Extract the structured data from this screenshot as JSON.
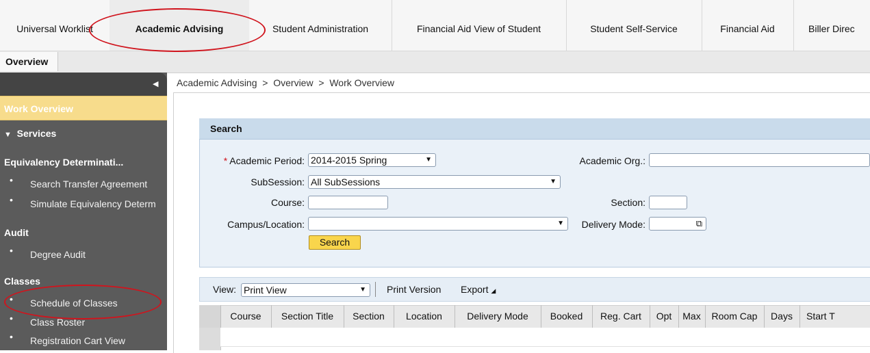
{
  "tabs": [
    {
      "label": "Universal Worklist"
    },
    {
      "label": "Academic Advising"
    },
    {
      "label": "Student Administration"
    },
    {
      "label": "Financial Aid View of Student"
    },
    {
      "label": "Student Self-Service"
    },
    {
      "label": "Financial Aid"
    },
    {
      "label": "Biller Direc"
    }
  ],
  "subnav": {
    "label": "Overview"
  },
  "sidebar": {
    "active": "Work Overview",
    "services": "Services",
    "sections": [
      {
        "title": "Equivalency Determinati...",
        "items": [
          "Search Transfer Agreement",
          "Simulate Equivalency Determ"
        ]
      },
      {
        "title": "Audit",
        "items": [
          "Degree Audit"
        ]
      },
      {
        "title": "Classes",
        "items": [
          "Schedule of Classes",
          "Class Roster",
          "Registration Cart View"
        ]
      }
    ]
  },
  "breadcrumb": "Academic Advising  >  Overview  >  Work Overview",
  "search": {
    "title": "Search",
    "required_mark": "*",
    "academic_period_label": "Academic Period:",
    "academic_period_value": "2014-2015 Spring",
    "subsession_label": "SubSession:",
    "subsession_value": "All SubSessions",
    "course_label": "Course:",
    "course_value": "",
    "campus_label": "Campus/Location:",
    "campus_value": "",
    "academic_org_label": "Academic Org.:",
    "academic_org_value": "",
    "section_label": "Section:",
    "section_value": "",
    "delivery_label": "Delivery Mode:",
    "delivery_value": "",
    "button": "Search"
  },
  "results": {
    "view_label": "View:",
    "view_value": "Print View",
    "print_version": "Print Version",
    "export": "Export",
    "columns": [
      "Course",
      "Section Title",
      "Section",
      "Location",
      "Delivery Mode",
      "Booked",
      "Reg. Cart",
      "Opt",
      "Max",
      "Room Cap",
      "Days",
      "Start T"
    ]
  },
  "annotation_color": "#d0141d"
}
